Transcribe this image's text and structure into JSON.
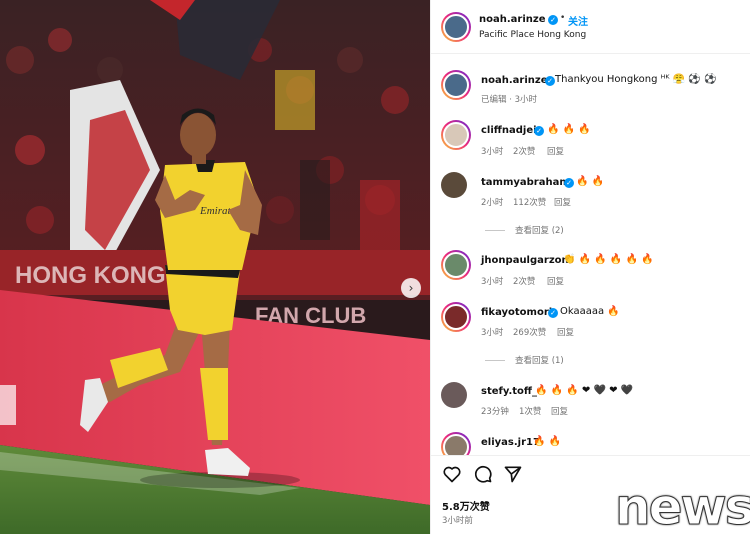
{
  "post": {
    "author": "noah.arinze",
    "follow_label": "关注",
    "location": "Pacific Place Hong Kong",
    "caption_user": "noah.arinze",
    "caption_text": "Thankyou Hongkong ᴴᴷ 😤 ⚽ ⚽",
    "caption_meta": "已编辑 · 3小时",
    "likes": "5.8万次赞",
    "posted": "3小时前"
  },
  "photo": {
    "banner_left": "HONG KONG",
    "banner_right": "FAN CLUB",
    "shirt_sponsor": "Emirates"
  },
  "comments": [
    {
      "user": "cliffnadjei",
      "verified": true,
      "text": "🔥 🔥 🔥",
      "time": "3小时",
      "likes": "2次赞",
      "reply": "回复"
    },
    {
      "user": "tammyabraham",
      "verified": true,
      "text": "🔥 🔥",
      "time": "2小时",
      "likes": "112次赞",
      "reply": "回复",
      "view_replies": "查看回复 (2)"
    },
    {
      "user": "jhonpaulgarzon",
      "verified": false,
      "text": "👏 🔥 🔥 🔥 🔥 🔥",
      "time": "3小时",
      "likes": "2次赞",
      "reply": "回复"
    },
    {
      "user": "fikayotomori",
      "verified": true,
      "text": "Okaaaaa 🔥",
      "time": "3小时",
      "likes": "269次赞",
      "reply": "回复",
      "view_replies": "查看回复 (1)"
    },
    {
      "user": "stefy.toff_",
      "verified": false,
      "text": "🔥 🔥 🔥 ❤ 🖤 ❤ 🖤",
      "time": "23分钟",
      "likes": "1次赞",
      "reply": "回复"
    },
    {
      "user": "eliyas.jr17",
      "verified": false,
      "text": "🔥 🔥",
      "time": "",
      "likes": "",
      "reply": ""
    }
  ],
  "icons": [
    "heart-icon",
    "comment-icon",
    "share-icon",
    "verified-icon",
    "chevron-right-icon"
  ],
  "colors": {
    "accent": "#0095f6",
    "jersey": "#f2d22e",
    "crowd": "#8b1a1f",
    "ad_board": "#e8384f"
  },
  "watermark": "news"
}
